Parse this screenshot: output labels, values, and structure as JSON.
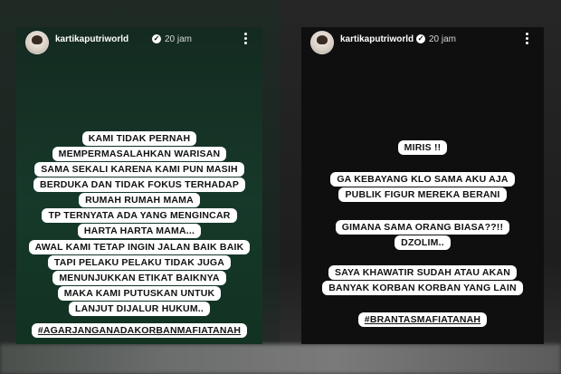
{
  "left_post": {
    "username": "kartikaputriworld",
    "time": "20 jam",
    "paragraph1": [
      "KAMI TIDAK PERNAH",
      "MEMPERMASALAHKAN WARISAN",
      "SAMA SEKALI KARENA KAMI PUN MASIH",
      "BERDUKA DAN TIDAK FOKUS TERHADAP",
      "RUMAH RUMAH MAMA",
      "TP TERNYATA ADA YANG MENGINCAR",
      "HARTA HARTA MAMA..."
    ],
    "paragraph2": [
      "AWAL KAMI TETAP INGIN JALAN BAIK BAIK",
      "TAPI PELAKU PELAKU TIDAK JUGA",
      "MENUNJUKKAN ETIKAT BAIKNYA",
      "MAKA KAMI PUTUSKAN UNTUK",
      "LANJUT DIJALUR HUKUM.."
    ],
    "hashtag": "#AGARJANGANADAKORBANMAFIATANAH"
  },
  "right_post": {
    "username": "kartikaputriworld",
    "time": "20 jam",
    "line1": [
      "MIRIS !!"
    ],
    "line2": [
      "GA KEBAYANG KLO SAMA AKU AJA",
      "PUBLIK FIGUR MEREKA BERANI"
    ],
    "line3": [
      "GIMANA SAMA ORANG BIASA??!!",
      "DZOLIM.."
    ],
    "line4": [
      "SAYA KHAWATIR SUDAH ATAU AKAN",
      "BANYAK KORBAN KORBAN YANG LAIN"
    ],
    "hashtag": "#BRANTASMAFIATANAH"
  }
}
